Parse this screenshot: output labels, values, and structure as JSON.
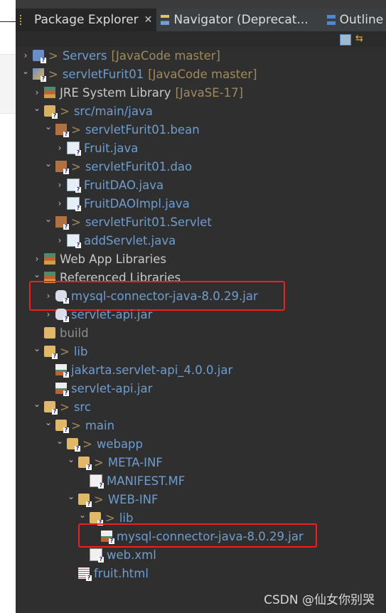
{
  "tabs": [
    {
      "label": "Package Explorer",
      "active": true,
      "closable": true,
      "icon": "package-explorer-icon"
    },
    {
      "label": "Navigator (Deprecat...",
      "active": false,
      "icon": "navigator-icon"
    },
    {
      "label": "Outline",
      "active": false,
      "icon": "outline-icon"
    }
  ],
  "toolbar": [
    {
      "icon": "collapse-all-icon"
    },
    {
      "icon": "link-with-editor-icon"
    }
  ],
  "tree": [
    {
      "level": 0,
      "arrow": "collapsed",
      "icon": "server-folder",
      "dec": ">",
      "label": "Servers",
      "suffix": "[JavaCode master]",
      "style": "git"
    },
    {
      "level": 0,
      "arrow": "expanded",
      "icon": "project",
      "dec": ">",
      "label": "servletFurit01",
      "suffix": "[JavaCode master]",
      "style": "git"
    },
    {
      "level": 1,
      "arrow": "collapsed",
      "icon": "library",
      "label": "JRE System Library",
      "suffix": "[JavaSE-17]",
      "style": "plain"
    },
    {
      "level": 1,
      "arrow": "expanded",
      "icon": "source-folder",
      "dec": ">",
      "label": "src/main/java",
      "style": "git"
    },
    {
      "level": 2,
      "arrow": "expanded",
      "icon": "package",
      "dec": ">",
      "label": "servletFurit01.bean",
      "style": "git"
    },
    {
      "level": 3,
      "arrow": "collapsed",
      "icon": "java-file",
      "label": "Fruit.java",
      "style": "git"
    },
    {
      "level": 2,
      "arrow": "expanded",
      "icon": "package",
      "dec": ">",
      "label": "servletFurit01.dao",
      "style": "git"
    },
    {
      "level": 3,
      "arrow": "collapsed",
      "icon": "java-file",
      "label": "FruitDAO.java",
      "style": "git"
    },
    {
      "level": 3,
      "arrow": "collapsed",
      "icon": "java-file",
      "label": "FruitDAOImpl.java",
      "style": "git"
    },
    {
      "level": 2,
      "arrow": "expanded",
      "icon": "package",
      "dec": ">",
      "label": "servletFurit01.Servlet",
      "style": "git"
    },
    {
      "level": 3,
      "arrow": "collapsed",
      "icon": "java-file",
      "label": "addServlet.java",
      "style": "git"
    },
    {
      "level": 1,
      "arrow": "collapsed",
      "icon": "library",
      "label": "Web App Libraries",
      "style": "plain"
    },
    {
      "level": 1,
      "arrow": "expanded",
      "icon": "library",
      "label": "Referenced Libraries",
      "style": "plain"
    },
    {
      "level": 2,
      "arrow": "collapsed",
      "icon": "jar",
      "label": "mysql-connector-java-8.0.29.jar",
      "style": "git",
      "highlighted": true
    },
    {
      "level": 2,
      "arrow": "collapsed",
      "icon": "jar",
      "label": "servlet-api.jar",
      "style": "git"
    },
    {
      "level": 1,
      "arrow": "none",
      "icon": "folder",
      "label": "build",
      "style": "dim"
    },
    {
      "level": 1,
      "arrow": "expanded",
      "icon": "folder",
      "dec": ">",
      "label": "lib",
      "style": "git"
    },
    {
      "level": 2,
      "arrow": "none",
      "icon": "jar-file",
      "label": "jakarta.servlet-api_4.0.0.jar",
      "style": "git"
    },
    {
      "level": 2,
      "arrow": "none",
      "icon": "jar-file",
      "label": "servlet-api.jar",
      "style": "git"
    },
    {
      "level": 1,
      "arrow": "expanded",
      "icon": "folder",
      "dec": ">",
      "label": "src",
      "style": "git"
    },
    {
      "level": 2,
      "arrow": "expanded",
      "icon": "folder",
      "dec": ">",
      "label": "main",
      "style": "git"
    },
    {
      "level": 3,
      "arrow": "expanded",
      "icon": "folder",
      "dec": ">",
      "label": "webapp",
      "style": "git"
    },
    {
      "level": 4,
      "arrow": "expanded",
      "icon": "folder",
      "dec": ">",
      "label": "META-INF",
      "style": "git"
    },
    {
      "level": 5,
      "arrow": "none",
      "icon": "file",
      "label": "MANIFEST.MF",
      "style": "git"
    },
    {
      "level": 4,
      "arrow": "expanded",
      "icon": "folder",
      "dec": ">",
      "label": "WEB-INF",
      "style": "git"
    },
    {
      "level": 5,
      "arrow": "expanded",
      "icon": "folder",
      "dec": ">",
      "label": "lib",
      "style": "git"
    },
    {
      "level": 6,
      "arrow": "none",
      "icon": "jar-file",
      "label": "mysql-connector-java-8.0.29.jar",
      "style": "git",
      "highlighted": true
    },
    {
      "level": 5,
      "arrow": "none",
      "icon": "xml-file",
      "label": "web.xml",
      "style": "git"
    },
    {
      "level": 4,
      "arrow": "none",
      "icon": "html-file",
      "label": "fruit.html",
      "style": "git"
    }
  ],
  "watermark": "CSDN @仙女你别哭",
  "colors": {
    "background": "#2f2f2f",
    "git_label": "#6e9dcf",
    "decoration": "#a08a5a",
    "highlight": "#f01e1e"
  }
}
